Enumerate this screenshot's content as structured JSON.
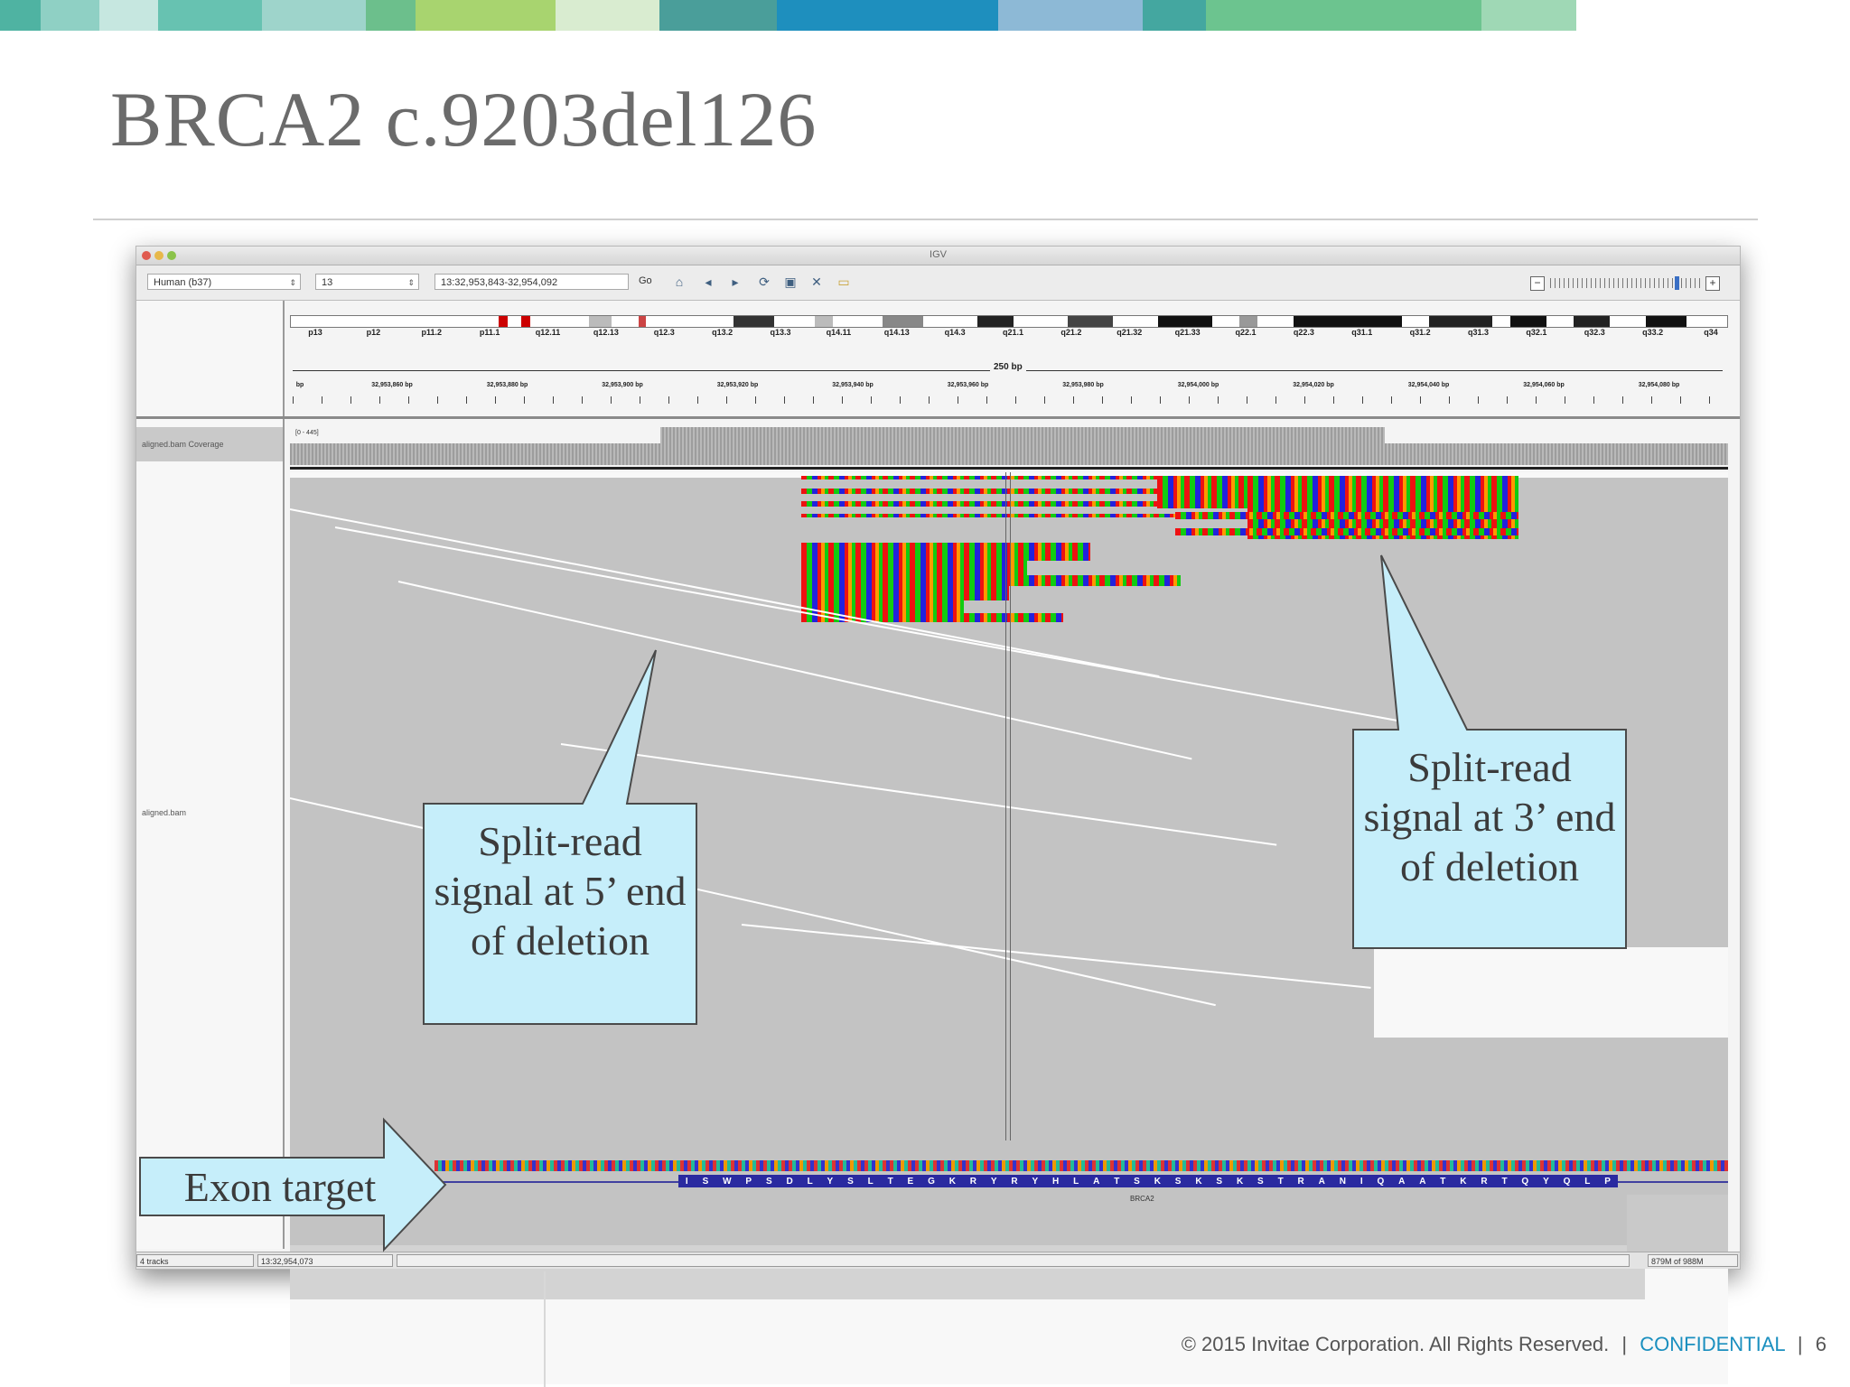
{
  "slide": {
    "title": "BRCA2 c.9203del126",
    "footer_copyright": "© 2015 Invitae Corporation. All Rights Reserved.",
    "footer_separator": "|",
    "footer_confidential": "CONFIDENTIAL",
    "page_number": "6",
    "top_bar_colors": [
      "#4fb3a2",
      "#8fd0c4",
      "#c6e7e0",
      "#67c2b1",
      "#9ed4cb",
      "#6cbf8c",
      "#a8d46f",
      "#d9ecd0",
      "#4a9e9a",
      "#1e8fbe",
      "#8db9d6",
      "#44a7a0",
      "#6cc48f",
      "#9fd8b5"
    ],
    "callouts": {
      "five_prime": "Split-read signal at 5’ end of deletion",
      "three_prime": "Split-read signal at 3’ end of deletion",
      "exon_target": "Exon target"
    },
    "callout_fill": "#c6eefa"
  },
  "igv": {
    "window_title": "IGV",
    "genome_select": "Human (b37)",
    "chromosome_select": "13",
    "locus": "13:32,953,843-32,954,092",
    "go_label": "Go",
    "toolbar_icons": [
      "home-icon",
      "back-arrow-icon",
      "forward-arrow-icon",
      "refresh-icon",
      "region-icon",
      "resize-icon",
      "popup-text-icon"
    ],
    "cytobands": [
      "p13",
      "p12",
      "p11.2",
      "p11.1",
      "q12.11",
      "q12.13",
      "q12.3",
      "q13.2",
      "q13.3",
      "q14.11",
      "q14.13",
      "q14.3",
      "q21.1",
      "q21.2",
      "q21.32",
      "q21.33",
      "q22.1",
      "q22.3",
      "q31.1",
      "q31.2",
      "q31.3",
      "q32.1",
      "q32.3",
      "q33.2",
      "q34"
    ],
    "ruler_span": "250 bp",
    "ruler_first": "bp",
    "ruler_ticks": [
      "32,953,860 bp",
      "32,953,880 bp",
      "32,953,900 bp",
      "32,953,920 bp",
      "32,953,940 bp",
      "32,953,960 bp",
      "32,953,980 bp",
      "32,954,000 bp",
      "32,954,020 bp",
      "32,954,040 bp",
      "32,954,060 bp",
      "32,954,080 bp"
    ],
    "coverage_track_name": "aligned.bam Coverage",
    "coverage_range": "[0 - 445]",
    "alignment_track_name": "aligned.bam",
    "amino_acids": [
      "I",
      "S",
      "W",
      "P",
      "S",
      "D",
      "L",
      "Y",
      "S",
      "L",
      "T",
      "E",
      "G",
      "K",
      "R",
      "Y",
      "R",
      "Y",
      "H",
      "L",
      "A",
      "T",
      "S",
      "K",
      "S",
      "K",
      "S",
      "K",
      "S",
      "T",
      "R",
      "A",
      "N",
      "I",
      "Q",
      "A",
      "A",
      "T",
      "K",
      "R",
      "T",
      "Q",
      "Y",
      "Q",
      "L",
      "P"
    ],
    "gene_name": "BRCA2",
    "status_tracks": "4 tracks",
    "status_position": "13:32,954,073",
    "status_memory": "879M of 988M"
  }
}
